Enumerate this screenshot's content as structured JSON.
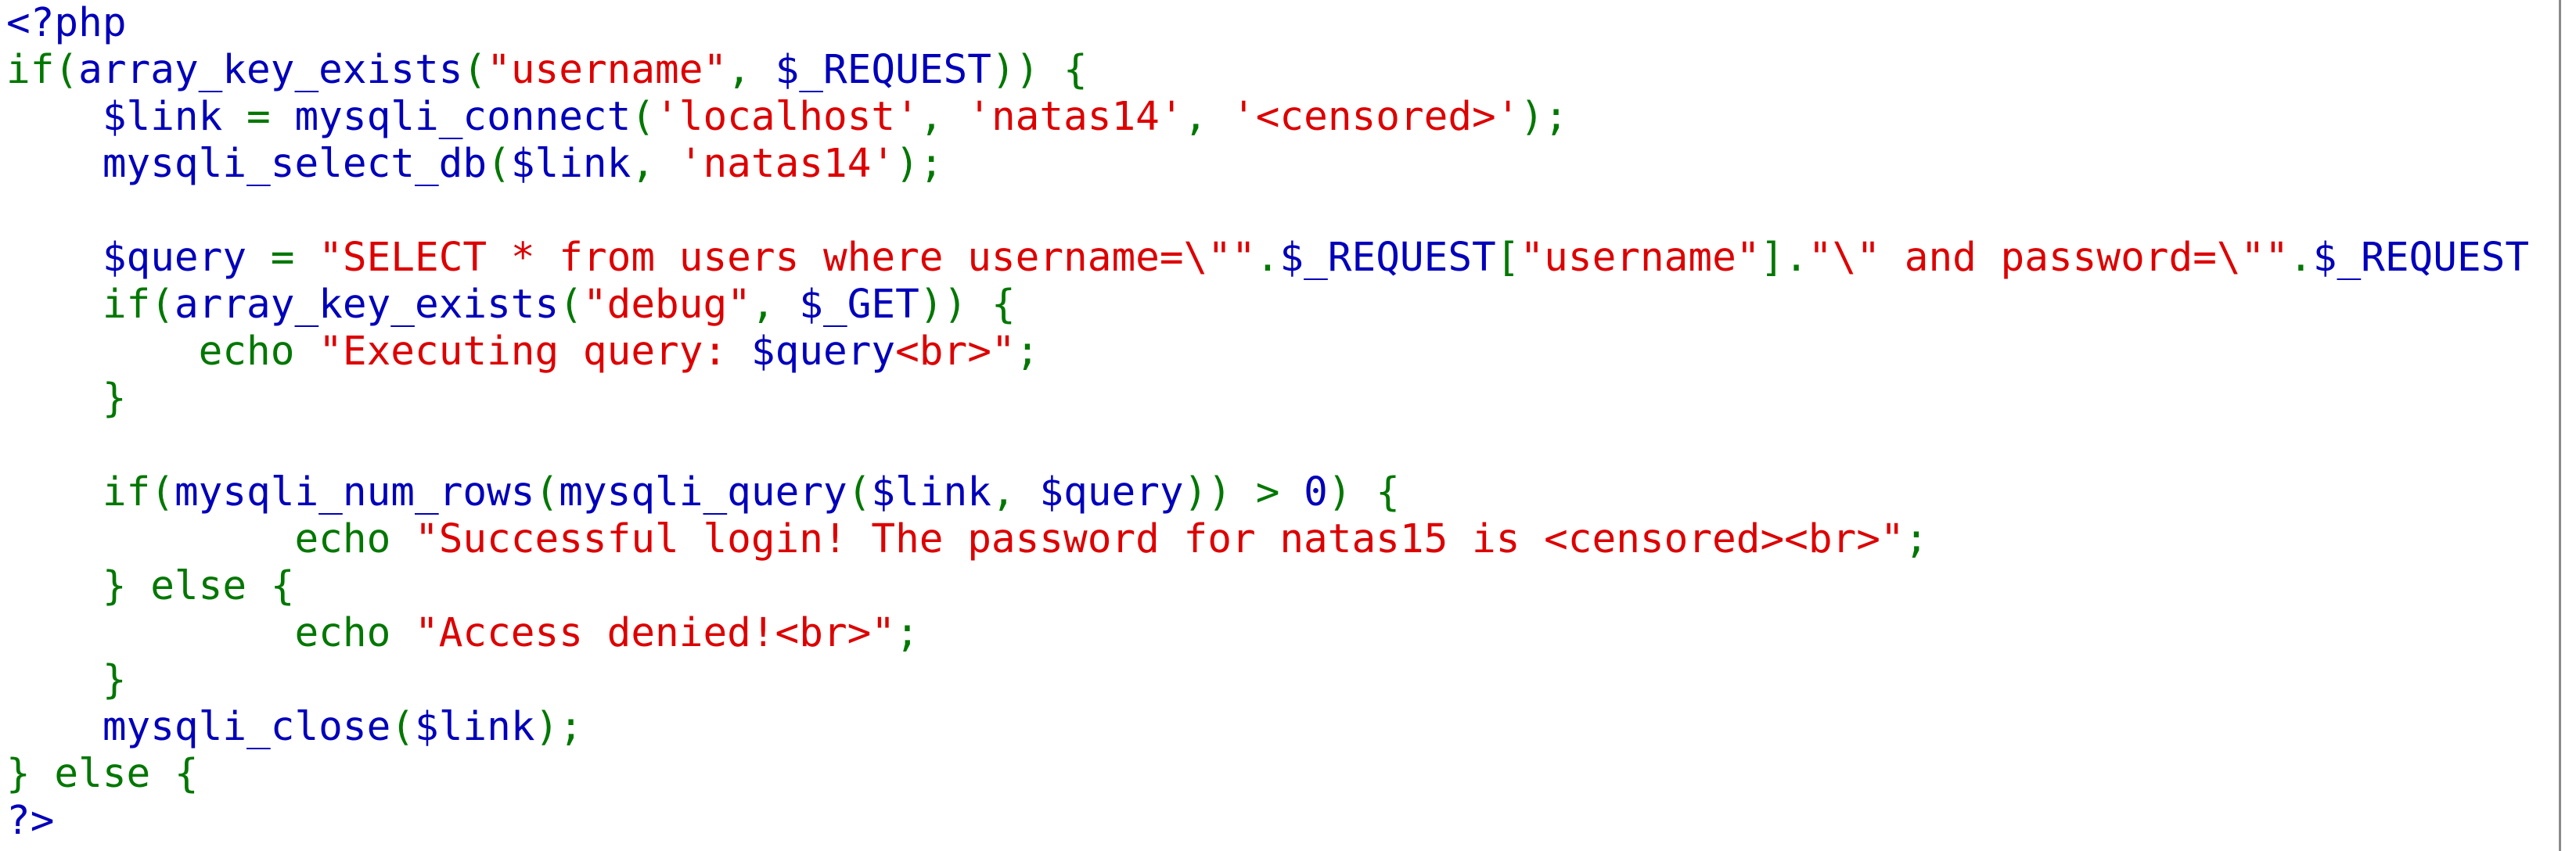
{
  "colors": {
    "default": "#0000bb",
    "keyword": "#007700",
    "string": "#dd0000",
    "background": "#ffffff"
  },
  "code_lines": [
    [
      {
        "t": "d",
        "s": "<?php"
      }
    ],
    [
      {
        "t": "k",
        "s": "if("
      },
      {
        "t": "d",
        "s": "array_key_exists"
      },
      {
        "t": "k",
        "s": "("
      },
      {
        "t": "s",
        "s": "\"username\""
      },
      {
        "t": "k",
        "s": ", "
      },
      {
        "t": "d",
        "s": "$_REQUEST"
      },
      {
        "t": "k",
        "s": ")) {"
      }
    ],
    [
      {
        "t": "d",
        "s": "    $link "
      },
      {
        "t": "k",
        "s": "= "
      },
      {
        "t": "d",
        "s": "mysqli_connect"
      },
      {
        "t": "k",
        "s": "("
      },
      {
        "t": "s",
        "s": "'localhost'"
      },
      {
        "t": "k",
        "s": ", "
      },
      {
        "t": "s",
        "s": "'natas14'"
      },
      {
        "t": "k",
        "s": ", "
      },
      {
        "t": "s",
        "s": "'<censored>'"
      },
      {
        "t": "k",
        "s": ");"
      }
    ],
    [
      {
        "t": "d",
        "s": "    mysqli_select_db"
      },
      {
        "t": "k",
        "s": "("
      },
      {
        "t": "d",
        "s": "$link"
      },
      {
        "t": "k",
        "s": ", "
      },
      {
        "t": "s",
        "s": "'natas14'"
      },
      {
        "t": "k",
        "s": ");"
      }
    ],
    [],
    [
      {
        "t": "d",
        "s": "    $query "
      },
      {
        "t": "k",
        "s": "= "
      },
      {
        "t": "s",
        "s": "\"SELECT * from users where username=\\\"\""
      },
      {
        "t": "k",
        "s": "."
      },
      {
        "t": "d",
        "s": "$_REQUEST"
      },
      {
        "t": "k",
        "s": "["
      },
      {
        "t": "s",
        "s": "\"username\""
      },
      {
        "t": "k",
        "s": "]."
      },
      {
        "t": "s",
        "s": "\"\\\" and password=\\\"\""
      },
      {
        "t": "k",
        "s": "."
      },
      {
        "t": "d",
        "s": "$_REQUEST"
      }
    ],
    [
      {
        "t": "k",
        "s": "    if("
      },
      {
        "t": "d",
        "s": "array_key_exists"
      },
      {
        "t": "k",
        "s": "("
      },
      {
        "t": "s",
        "s": "\"debug\""
      },
      {
        "t": "k",
        "s": ", "
      },
      {
        "t": "d",
        "s": "$_GET"
      },
      {
        "t": "k",
        "s": ")) {"
      }
    ],
    [
      {
        "t": "k",
        "s": "        echo "
      },
      {
        "t": "s",
        "s": "\"Executing query: "
      },
      {
        "t": "d",
        "s": "$query"
      },
      {
        "t": "s",
        "s": "<br>\""
      },
      {
        "t": "k",
        "s": ";"
      }
    ],
    [
      {
        "t": "k",
        "s": "    }"
      }
    ],
    [],
    [
      {
        "t": "k",
        "s": "    if("
      },
      {
        "t": "d",
        "s": "mysqli_num_rows"
      },
      {
        "t": "k",
        "s": "("
      },
      {
        "t": "d",
        "s": "mysqli_query"
      },
      {
        "t": "k",
        "s": "("
      },
      {
        "t": "d",
        "s": "$link"
      },
      {
        "t": "k",
        "s": ", "
      },
      {
        "t": "d",
        "s": "$query"
      },
      {
        "t": "k",
        "s": ")) > "
      },
      {
        "t": "d",
        "s": "0"
      },
      {
        "t": "k",
        "s": ") {"
      }
    ],
    [
      {
        "t": "k",
        "s": "            echo "
      },
      {
        "t": "s",
        "s": "\"Successful login! The password for natas15 is <censored><br>\""
      },
      {
        "t": "k",
        "s": ";"
      }
    ],
    [
      {
        "t": "k",
        "s": "    } else {"
      }
    ],
    [
      {
        "t": "k",
        "s": "            echo "
      },
      {
        "t": "s",
        "s": "\"Access denied!<br>\""
      },
      {
        "t": "k",
        "s": ";"
      }
    ],
    [
      {
        "t": "k",
        "s": "    }"
      }
    ],
    [
      {
        "t": "d",
        "s": "    mysqli_close"
      },
      {
        "t": "k",
        "s": "("
      },
      {
        "t": "d",
        "s": "$link"
      },
      {
        "t": "k",
        "s": ");"
      }
    ],
    [
      {
        "t": "k",
        "s": "} else {"
      }
    ],
    [
      {
        "t": "d",
        "s": "?>"
      }
    ]
  ]
}
